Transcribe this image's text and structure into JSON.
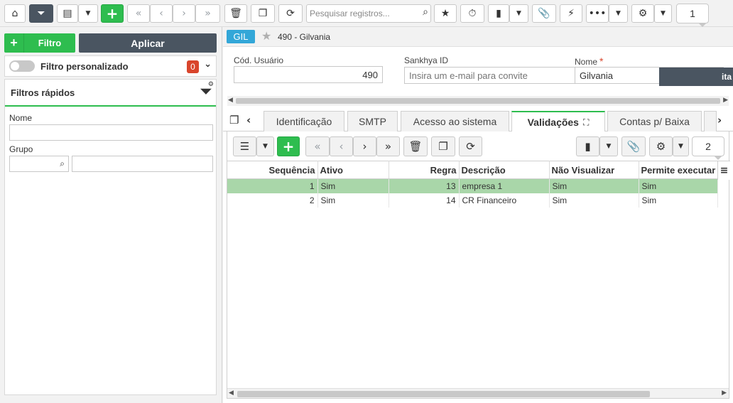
{
  "toolbar": {
    "search_placeholder": "Pesquisar registros...",
    "page": "1",
    "icons": [
      "home-icon",
      "filter-icon",
      "grid-view-icon",
      "add-icon",
      "first-icon",
      "prev-icon",
      "next-icon",
      "last-icon",
      "delete-icon",
      "duplicate-icon",
      "refresh-icon",
      "search-icon",
      "star-icon",
      "stopwatch-icon",
      "export-icon",
      "attach-icon",
      "lightning-icon",
      "more-icon",
      "gear-icon"
    ]
  },
  "left": {
    "filtro_label": "Filtro",
    "aplicar_label": "Aplicar",
    "filtro_personalizado_label": "Filtro personalizado",
    "filtro_count": "0",
    "filtros_rapidos_title": "Filtros rápidos",
    "nome_label": "Nome",
    "grupo_label": "Grupo"
  },
  "record": {
    "badge": "GIL",
    "title": "490 - Gilvania"
  },
  "form": {
    "cod_usuario_label": "Cód. Usuário",
    "cod_usuario_value": "490",
    "sankhya_id_label": "Sankhya ID",
    "sankhya_id_placeholder": "Insira um e-mail para convite",
    "nome_label": "Nome",
    "nome_required": "*",
    "nome_value": "Gilvania",
    "dark_button_label": "ita"
  },
  "tabs": [
    {
      "label": "Identificação"
    },
    {
      "label": "SMTP"
    },
    {
      "label": "Acesso ao sistema"
    },
    {
      "label": "Validações",
      "active": true
    },
    {
      "label": "Contas p/ Baixa"
    }
  ],
  "grid": {
    "page": "2",
    "columns": [
      "Sequência",
      "Ativo",
      "Regra",
      "Descrição",
      "Não Visualizar",
      "Permite executar"
    ],
    "rows": [
      {
        "sequencia": "1",
        "ativo": "Sim",
        "regra": "13",
        "descricao": "empresa 1",
        "nao_visualizar": "Sim",
        "permite_executar": "Sim",
        "selected": true
      },
      {
        "sequencia": "2",
        "ativo": "Sim",
        "regra": "14",
        "descricao": "CR Financeiro",
        "nao_visualizar": "Sim",
        "permite_executar": "Sim",
        "selected": false
      }
    ]
  },
  "colors": {
    "accent_green": "#2ebd4f",
    "dark_button": "#4a5561",
    "badge_blue": "#33a7d8",
    "badge_red": "#d9452c",
    "selected_row": "#a9d6a9"
  }
}
